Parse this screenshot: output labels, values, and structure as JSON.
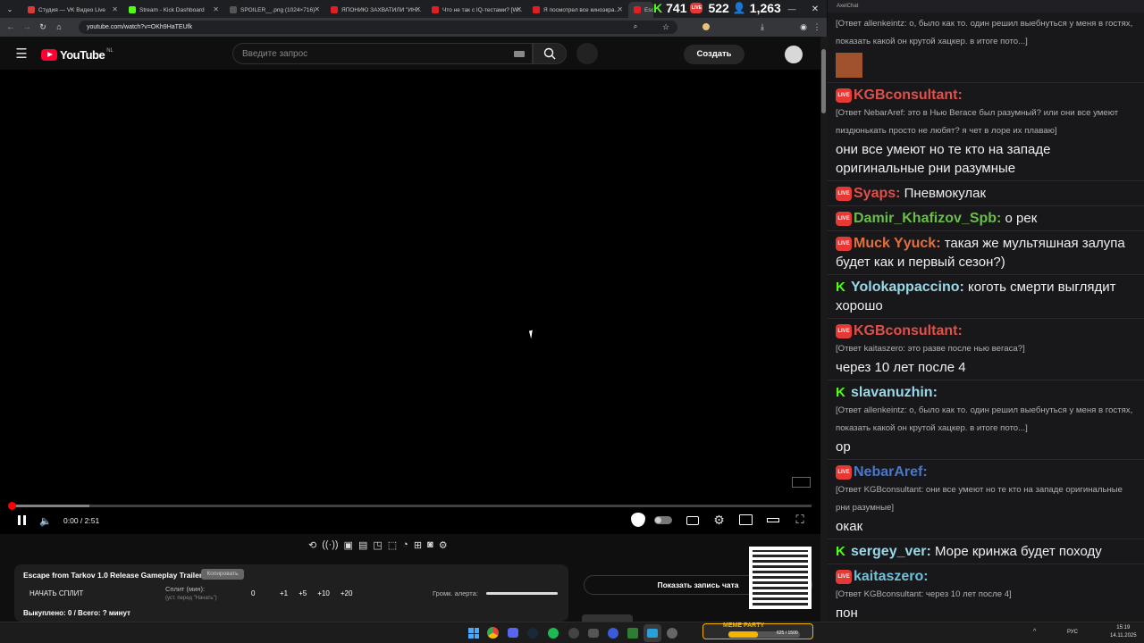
{
  "browser": {
    "tabs": [
      {
        "title": "Студия — VK Видео Live",
        "color": "#d93a3a"
      },
      {
        "title": "Stream - Kick Dashboard",
        "color": "#53fc18"
      },
      {
        "title": "SPOILER__.png (1024×716)",
        "color": "#555555"
      },
      {
        "title": "ЯПОНИЮ ЗАХВАТИЛИ \"ИН...",
        "color": "#e02020"
      },
      {
        "title": "Что не так с IQ-тестами? [W...",
        "color": "#e02020"
      },
      {
        "title": "Я посмотрел все киноэкра...",
        "color": "#e02020"
      },
      {
        "title": "Esc",
        "color": "#e02020"
      }
    ],
    "url": "youtube.com/watch?v=OKh9HaTEUfk"
  },
  "overlay_stats": {
    "kick": "741",
    "vk": "522",
    "total": "1,263"
  },
  "youtube": {
    "logo": "YouTube",
    "region": "NL",
    "search_placeholder": "Введите запрос",
    "create_label": "Создать",
    "time": "0:00 / 2:51",
    "progress": 0.0
  },
  "widget": {
    "title": "Escape from Tarkov 1.0 Release Gameplay Trailer",
    "copy_label": "Копировать",
    "start_label": "НАЧАТЬ СПЛИТ",
    "split_label": "Сплит (мин):",
    "split_hint": "(уст. перед \"Начать\")",
    "split_value": "0",
    "increments": [
      "+1",
      "+5",
      "+10",
      "+20"
    ],
    "alert_label": "Громк. алерта:",
    "alert_volume": 1.0,
    "bought": "Выкуплено: 0 / Всего: ? минут",
    "show_chat_label": "Показать запись чата"
  },
  "chat": {
    "window_title": "AxelChat",
    "messages": [
      {
        "id": "m0",
        "platform": "none",
        "nick": "",
        "nick_color": "#ffffff",
        "reply": "[Ответ allenkeintz: о, было как то. один решил выебнуться у меня в гостях, показать какой он крутой хацкер. в итоге пото...]",
        "text": "",
        "emote": true
      },
      {
        "id": "m1",
        "platform": "vk",
        "nick": "KGBconsultant:",
        "nick_color": "#e0504a",
        "reply": "[Ответ NebarAref: это в Нью Вегасе был разумный? или они все умеют пиздюнькать просто не любят? я чет в лоре их плаваю]",
        "text": "они все умеют но те кто на западе оригинальные рни разумные",
        "emote": false
      },
      {
        "id": "m2",
        "platform": "vk",
        "nick": "Syaps:",
        "nick_color": "#e0504a",
        "reply": "",
        "text": "Пневмокулак",
        "emote": false
      },
      {
        "id": "m3",
        "platform": "vk",
        "nick": "Damir_Khafizov_Spb:",
        "nick_color": "#6bbd4a",
        "reply": "",
        "text": "о рек",
        "emote": false
      },
      {
        "id": "m4",
        "platform": "vk",
        "nick": "Muck Yyuck:",
        "nick_color": "#e07040",
        "reply": "",
        "text": "такая же мультяшная залупа будет как и первый сезон?)",
        "emote": false
      },
      {
        "id": "m5",
        "platform": "kick",
        "nick": "Yolokappaccino:",
        "nick_color": "#9ad8e8",
        "reply": "",
        "text": "коготь смерти выглядит хорошо",
        "emote": false
      },
      {
        "id": "m6",
        "platform": "vk",
        "nick": "KGBconsultant:",
        "nick_color": "#e0504a",
        "reply": "[Ответ kaitaszero: это разве после нью вегаса?]",
        "text": "через 10 лет после 4",
        "emote": false
      },
      {
        "id": "m7",
        "platform": "kick",
        "nick": "slavanuzhin:",
        "nick_color": "#9ad8e8",
        "reply": "[Ответ allenkeintz: о, было как то. один решил выебнуться у меня в гостях, показать какой он крутой хацкер. в итоге пото...]",
        "text": "ор",
        "emote": false
      },
      {
        "id": "m8",
        "platform": "vk",
        "nick": "NebarAref:",
        "nick_color": "#4a78c8",
        "reply": "[Ответ KGBconsultant: они все умеют но те кто на западе оригинальные рни разумные]",
        "text": "окак",
        "emote": false
      },
      {
        "id": "m9",
        "platform": "kick",
        "nick": "sergey_ver:",
        "nick_color": "#9ad8e8",
        "reply": "",
        "text": "Море кринжа будет походу",
        "emote": false
      },
      {
        "id": "m10",
        "platform": "vk",
        "nick": "kaitaszero:",
        "nick_color": "#6fc0d8",
        "reply": "[Ответ KGBconsultant: через 10 лет после 4]",
        "text": "пон",
        "emote": false
      }
    ]
  },
  "taskbar": {
    "lang": "РУС",
    "time": "15:19",
    "date": "14.11.2025",
    "meme_label": "MEME PARTY",
    "meme_counter": "625 / 1500"
  }
}
